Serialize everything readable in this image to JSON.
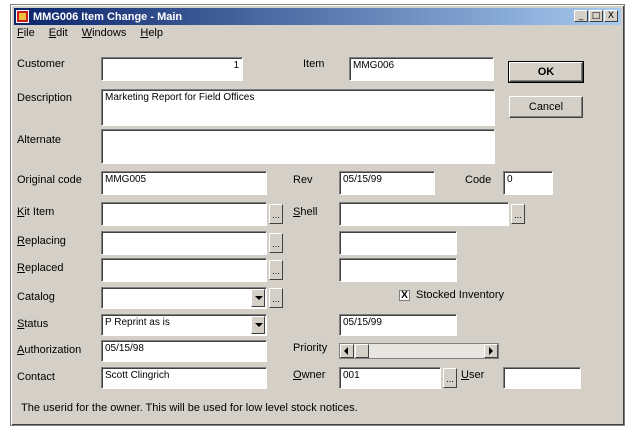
{
  "window": {
    "title": "MMG006 Item Change - Main",
    "controls": {
      "minimize": "_",
      "restore": "□",
      "close": "X"
    }
  },
  "menu": [
    "File",
    "Edit",
    "Windows",
    "Help"
  ],
  "labels": {
    "customer": "Customer",
    "item": "Item",
    "description": "Description",
    "alternate": "Alternate",
    "original_code": "Original code",
    "rev": "Rev",
    "code": "Code",
    "kit_item": "Kit Item",
    "shell": "Shell",
    "replacing": "Replacing",
    "replaced": "Replaced",
    "catalog": "Catalog",
    "stocked_inventory": "Stocked Inventory",
    "status": "Status",
    "authorization": "Authorization",
    "priority": "Priority",
    "contact": "Contact",
    "owner": "Owner",
    "user": "User"
  },
  "values": {
    "customer": "1",
    "item": "MMG006",
    "description": "Marketing Report for Field Offices",
    "alternate": "",
    "original_code": "MMG005",
    "rev": "05/15/99",
    "code": "0",
    "kit_item": "",
    "shell": "",
    "replacing": "",
    "replacing_right": "",
    "replaced": "",
    "replaced_right": "",
    "catalog": "",
    "stocked_inventory_checked": true,
    "stocked_inventory_mark": "X",
    "status": "P  Reprint as is",
    "status_date": "05/15/99",
    "authorization": "05/15/98",
    "contact": "Scott Clingrich",
    "owner": "001",
    "user": ""
  },
  "buttons": {
    "ok": "OK",
    "cancel": "Cancel",
    "ellipsis": "..."
  },
  "status_message": "The userid for the owner.  This will be used for low level stock notices."
}
